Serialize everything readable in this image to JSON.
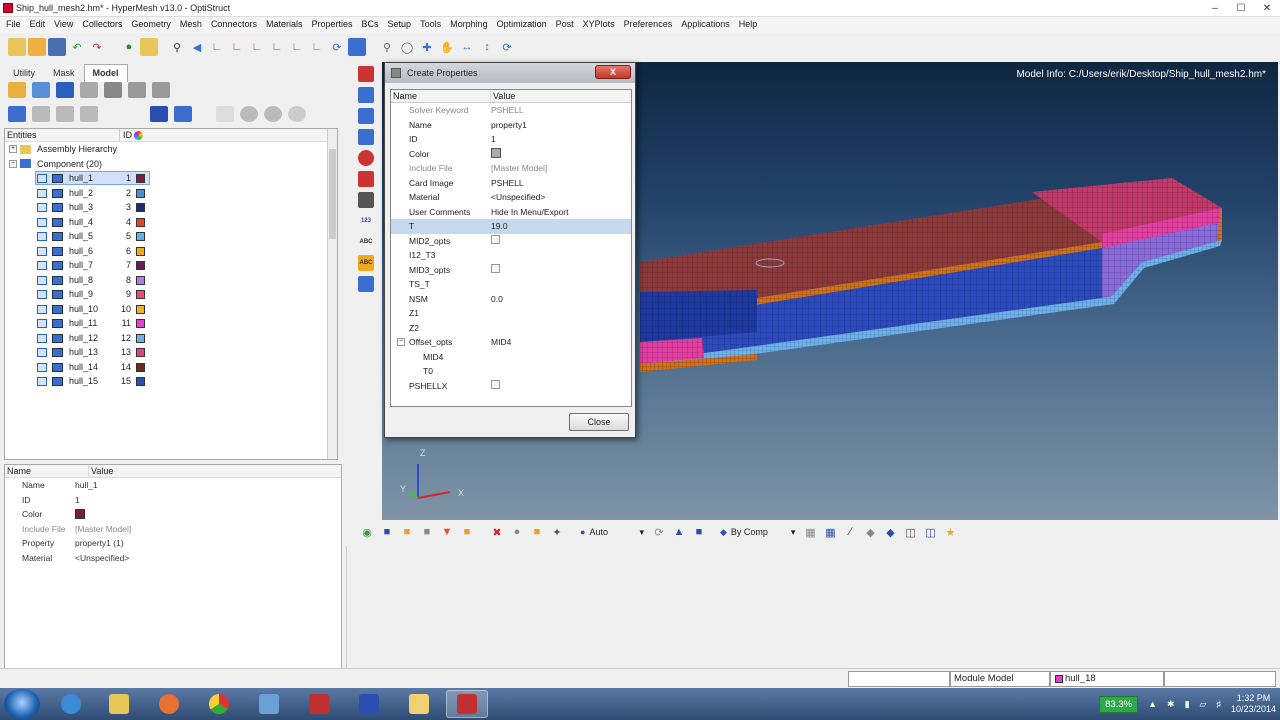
{
  "window": {
    "title": "Ship_hull_mesh2.hm* - HyperMesh v13.0 - OptiStruct"
  },
  "menu": [
    "File",
    "Edit",
    "View",
    "Collectors",
    "Geometry",
    "Mesh",
    "Connectors",
    "Materials",
    "Properties",
    "BCs",
    "Setup",
    "Tools",
    "Morphing",
    "Optimization",
    "Post",
    "XYPlots",
    "Preferences",
    "Applications",
    "Help"
  ],
  "left_tabs": [
    "Utility",
    "Mask",
    "Model"
  ],
  "entities": {
    "col_name": "Entities",
    "col_id": "ID",
    "assembly": "Assembly Hierarchy",
    "component": "Component (20)",
    "rows": [
      {
        "name": "hull_1",
        "id": "1",
        "color": "#7a1d3a"
      },
      {
        "name": "hull_2",
        "id": "2",
        "color": "#4a8fd8"
      },
      {
        "name": "hull_3",
        "id": "3",
        "color": "#1b2e6b"
      },
      {
        "name": "hull_4",
        "id": "4",
        "color": "#e0452a"
      },
      {
        "name": "hull_5",
        "id": "5",
        "color": "#5bb3e8"
      },
      {
        "name": "hull_6",
        "id": "6",
        "color": "#f0a820"
      },
      {
        "name": "hull_7",
        "id": "7",
        "color": "#6b1e4a"
      },
      {
        "name": "hull_8",
        "id": "8",
        "color": "#b07de0"
      },
      {
        "name": "hull_9",
        "id": "9",
        "color": "#e84a7a"
      },
      {
        "name": "hull_10",
        "id": "10",
        "color": "#f0b030"
      },
      {
        "name": "hull_11",
        "id": "11",
        "color": "#e040d0"
      },
      {
        "name": "hull_12",
        "id": "12",
        "color": "#6fb0e8"
      },
      {
        "name": "hull_13",
        "id": "13",
        "color": "#e04080"
      },
      {
        "name": "hull_14",
        "id": "14",
        "color": "#6a2a1a"
      },
      {
        "name": "hull_15",
        "id": "15",
        "color": "#2a4fb0"
      }
    ]
  },
  "properties_panel": {
    "col_name": "Name",
    "col_value": "Value",
    "rows": [
      {
        "key": "Name",
        "value": "hull_1"
      },
      {
        "key": "ID",
        "value": "1"
      },
      {
        "key": "Color",
        "value": ""
      },
      {
        "key": "Include File",
        "value": "[Master Model]",
        "gray": true
      },
      {
        "key": "Property",
        "value": "property1 (1)"
      },
      {
        "key": "Material",
        "value": "<Unspecified>"
      }
    ],
    "color_swatch": "#7a1d3a"
  },
  "viewport": {
    "model_info": "Model Info: C:/Users/erik/Desktop/Ship_hull_mesh2.hm*",
    "axis_x": "X",
    "axis_y": "Y",
    "axis_z": "Z"
  },
  "dialog": {
    "title": "Create Properties",
    "close_x": "X",
    "col_name": "Name",
    "col_value": "Value",
    "rows": [
      {
        "key": "Solver Keyword",
        "value": "PSHELL",
        "gray": true
      },
      {
        "key": "Name",
        "value": "property1"
      },
      {
        "key": "ID",
        "value": "1"
      },
      {
        "key": "Color",
        "value": "",
        "type": "swatch"
      },
      {
        "key": "Include File",
        "value": "[Master Model]",
        "gray": true
      },
      {
        "key": "Card Image",
        "value": "PSHELL"
      },
      {
        "key": "Material",
        "value": "<Unspecified>"
      },
      {
        "key": "User Comments",
        "value": "Hide In Menu/Export"
      },
      {
        "key": "T",
        "value": "19.0",
        "selected": true
      },
      {
        "key": "MID2_opts",
        "value": "",
        "type": "checkbox"
      },
      {
        "key": "I12_T3",
        "value": ""
      },
      {
        "key": "MID3_opts",
        "value": "",
        "type": "checkbox"
      },
      {
        "key": "TS_T",
        "value": ""
      },
      {
        "key": "NSM",
        "value": "0.0"
      },
      {
        "key": "Z1",
        "value": ""
      },
      {
        "key": "Z2",
        "value": ""
      },
      {
        "key": "Offset_opts",
        "value": "MID4",
        "type": "group"
      },
      {
        "key": "MID4",
        "value": "",
        "indent": true
      },
      {
        "key": "T0",
        "value": "",
        "indent": true
      },
      {
        "key": "PSHELLX",
        "value": "",
        "type": "checkbox"
      }
    ],
    "close_button": "Close"
  },
  "bottom_toolbar": {
    "auto_label": "Auto",
    "bycomp_label": "By Comp"
  },
  "statusbar": {
    "module": "Module Model",
    "component": "hull_18",
    "component_color": "#e040d0"
  },
  "taskbar": {
    "zoom": "83.3%",
    "time": "1:32 PM",
    "date": "10/23/2014"
  }
}
